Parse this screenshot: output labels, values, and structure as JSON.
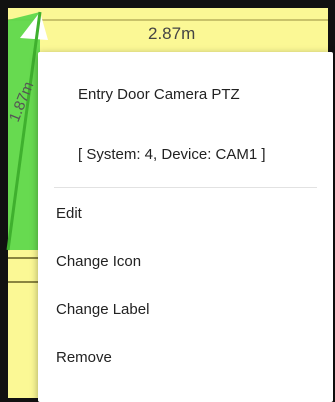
{
  "map": {
    "top_dimension": "2.87m",
    "left_dimension": "1.87m",
    "background_color": "#fbf895",
    "border_color": "#111111",
    "fov_color": "#5fd84c",
    "wall_color": "#b5b04a"
  },
  "context_menu": {
    "title": "Entry Door Camera PTZ",
    "subtitle": "[ System: 4, Device: CAM1 ]",
    "items": [
      {
        "label": "Edit"
      },
      {
        "label": "Change Icon"
      },
      {
        "label": "Change Label"
      },
      {
        "label": "Remove"
      }
    ]
  }
}
